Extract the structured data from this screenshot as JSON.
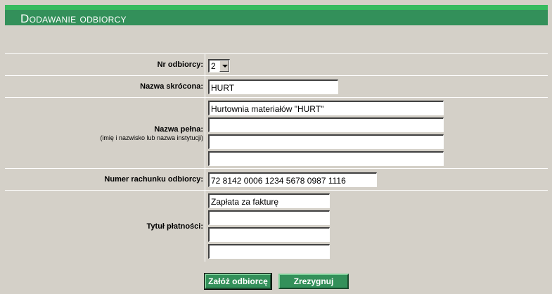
{
  "header": {
    "title": "Dodawanie odbiorcy"
  },
  "form": {
    "nr_odbiorcy": {
      "label": "Nr odbiorcy:",
      "value": "2"
    },
    "nazwa_skrocona": {
      "label": "Nazwa skrócona:",
      "value": "HURT"
    },
    "nazwa_pelna": {
      "label": "Nazwa pełna:",
      "sublabel": "(imię i nazwisko lub nazwa instytucji)",
      "lines": [
        "Hurtownia materiałów \"HURT\"",
        "",
        "",
        ""
      ]
    },
    "numer_rachunku": {
      "label": "Numer rachunku odbiorcy:",
      "value": "72 8142 0006 1234 5678 0987 1116"
    },
    "tytul_platnosci": {
      "label": "Tytuł płatności:",
      "lines": [
        "Zapłata za fakturę",
        "",
        "",
        ""
      ]
    }
  },
  "buttons": {
    "submit_label": "Załóż odbiorcę",
    "cancel_label": "Zrezygnuj"
  },
  "colors": {
    "header_green": "#33905a",
    "header_stripe": "#36bb5f",
    "background": "#d4d0c8"
  }
}
